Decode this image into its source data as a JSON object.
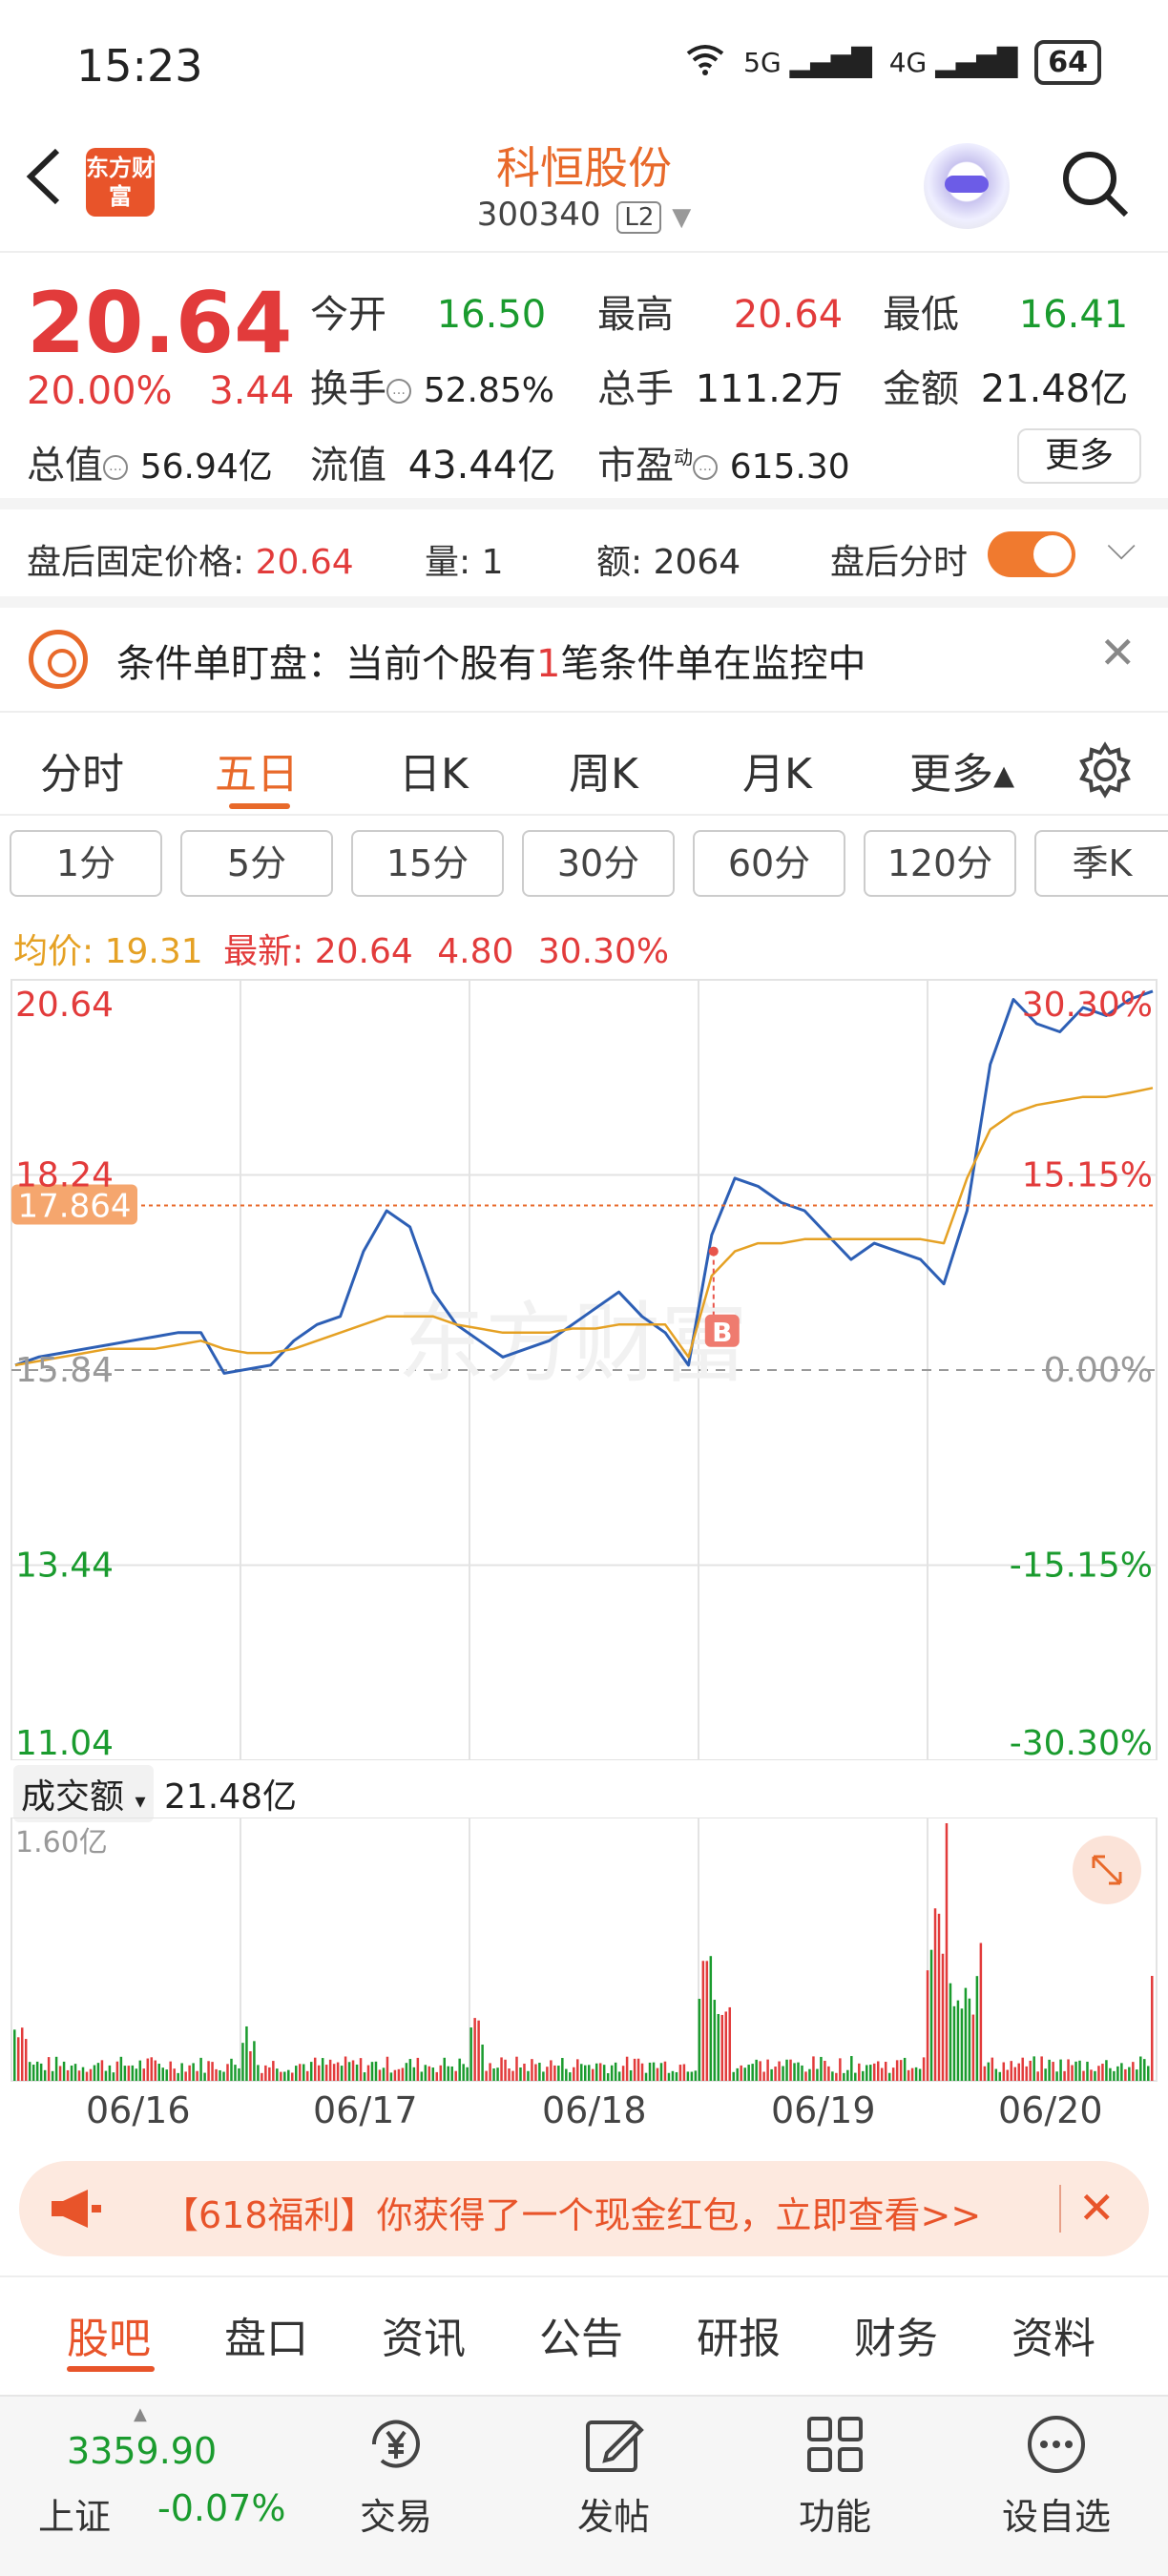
{
  "status_bar": {
    "time": "15:23",
    "network1": "5G",
    "network2": "4G",
    "battery": "64"
  },
  "header": {
    "logo_text": "东方财富",
    "stock_name": "科恒股份",
    "stock_code": "300340",
    "level": "L2"
  },
  "quote": {
    "price": "20.64",
    "change_pct": "20.00%",
    "change": "3.44",
    "open_label": "今开",
    "open": "16.50",
    "high_label": "最高",
    "high": "20.64",
    "low_label": "最低",
    "low": "16.41",
    "turnover_label": "换手",
    "turnover": "52.85%",
    "volume_label": "总手",
    "volume": "111.2万",
    "amount_label": "金额",
    "amount": "21.48亿",
    "mktcap_label": "总值",
    "mktcap": "56.94亿",
    "float_label": "流值",
    "float_cap": "43.44亿",
    "pe_label": "市盈",
    "pe_sup": "动",
    "pe": "615.30",
    "more_label": "更多"
  },
  "after_hours": {
    "price_label": "盘后固定价格:",
    "price": "20.64",
    "qty_label": "量:",
    "qty": "1",
    "amount_label": "额:",
    "amount": "2064",
    "toggle_label": "盘后分时"
  },
  "condition": {
    "prefix": "条件单盯盘：当前个股有",
    "count": "1",
    "suffix": "笔条件单在监控中"
  },
  "period_tabs": [
    "分时",
    "五日",
    "日K",
    "周K",
    "月K",
    "更多▴"
  ],
  "active_period": "五日",
  "minute_buttons": [
    "1分",
    "5分",
    "15分",
    "30分",
    "60分",
    "120分",
    "季K"
  ],
  "price_info": {
    "avg_label": "均价:",
    "avg": "19.31",
    "latest_label": "最新:",
    "latest": "20.64",
    "chg": "4.80",
    "pct": "30.30%"
  },
  "chart_data": {
    "type": "line",
    "title": "",
    "x_labels": [
      "06/16",
      "06/17",
      "06/18",
      "06/19",
      "06/20"
    ],
    "y_left_ticks": [
      "20.64",
      "18.24",
      "15.84",
      "13.44",
      "11.04"
    ],
    "y_right_ticks": [
      "30.30%",
      "15.15%",
      "0.00%",
      "-15.15%",
      "-30.30%"
    ],
    "ylim": [
      11.04,
      20.64
    ],
    "base_price": 15.84,
    "marker_price": "17.864",
    "buy_marker": "B",
    "watermark": "东方财富",
    "series": [
      {
        "name": "price",
        "color": "#2d5fb5",
        "values": [
          15.9,
          16.0,
          16.05,
          16.1,
          16.15,
          16.2,
          16.25,
          16.3,
          16.3,
          15.8,
          15.85,
          15.9,
          16.2,
          16.4,
          16.5,
          17.3,
          17.8,
          17.6,
          16.8,
          16.4,
          16.2,
          16.0,
          16.1,
          16.2,
          16.4,
          16.6,
          16.8,
          16.5,
          16.3,
          15.9,
          17.5,
          18.2,
          18.1,
          17.9,
          17.8,
          17.5,
          17.2,
          17.4,
          17.3,
          17.2,
          16.9,
          17.8,
          19.6,
          20.4,
          20.1,
          20.0,
          20.3,
          20.2,
          20.4,
          20.5
        ]
      },
      {
        "name": "avg",
        "color": "#e5a124",
        "values": [
          15.9,
          15.95,
          16.0,
          16.05,
          16.1,
          16.1,
          16.1,
          16.15,
          16.2,
          16.1,
          16.05,
          16.05,
          16.1,
          16.2,
          16.3,
          16.4,
          16.5,
          16.5,
          16.5,
          16.4,
          16.35,
          16.3,
          16.3,
          16.3,
          16.35,
          16.35,
          16.4,
          16.4,
          16.4,
          16.0,
          17.0,
          17.3,
          17.4,
          17.4,
          17.45,
          17.45,
          17.45,
          17.45,
          17.45,
          17.45,
          17.4,
          18.2,
          18.8,
          19.0,
          19.1,
          19.15,
          19.2,
          19.2,
          19.25,
          19.31
        ]
      }
    ],
    "volume": {
      "label": "成交额",
      "total": "21.48亿",
      "ymax_label": "1.60亿"
    }
  },
  "banner": {
    "text": "【618福利】你获得了一个现金红包，立即查看>>"
  },
  "bottom_tabs": [
    "股吧",
    "盘口",
    "资讯",
    "公告",
    "研报",
    "财务",
    "资料"
  ],
  "active_bottom_tab": "股吧",
  "bottom_nav": {
    "index_value": "3359.90",
    "index_name": "上证",
    "index_chg": "-0.07%",
    "items": [
      "交易",
      "发帖",
      "功能",
      "设自选"
    ]
  },
  "colors": {
    "accent": "#e8692a",
    "up": "#e23b3b",
    "down": "#1a9b2e",
    "price_line": "#2d5fb5",
    "avg_line": "#e5a124"
  }
}
